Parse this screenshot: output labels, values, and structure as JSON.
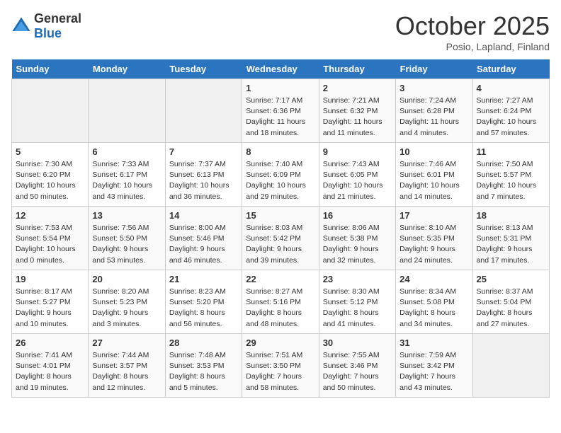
{
  "header": {
    "logo_general": "General",
    "logo_blue": "Blue",
    "month": "October 2025",
    "location": "Posio, Lapland, Finland"
  },
  "days_of_week": [
    "Sunday",
    "Monday",
    "Tuesday",
    "Wednesday",
    "Thursday",
    "Friday",
    "Saturday"
  ],
  "weeks": [
    [
      {
        "day": "",
        "info": ""
      },
      {
        "day": "",
        "info": ""
      },
      {
        "day": "",
        "info": ""
      },
      {
        "day": "1",
        "info": "Sunrise: 7:17 AM\nSunset: 6:36 PM\nDaylight: 11 hours\nand 18 minutes."
      },
      {
        "day": "2",
        "info": "Sunrise: 7:21 AM\nSunset: 6:32 PM\nDaylight: 11 hours\nand 11 minutes."
      },
      {
        "day": "3",
        "info": "Sunrise: 7:24 AM\nSunset: 6:28 PM\nDaylight: 11 hours\nand 4 minutes."
      },
      {
        "day": "4",
        "info": "Sunrise: 7:27 AM\nSunset: 6:24 PM\nDaylight: 10 hours\nand 57 minutes."
      }
    ],
    [
      {
        "day": "5",
        "info": "Sunrise: 7:30 AM\nSunset: 6:20 PM\nDaylight: 10 hours\nand 50 minutes."
      },
      {
        "day": "6",
        "info": "Sunrise: 7:33 AM\nSunset: 6:17 PM\nDaylight: 10 hours\nand 43 minutes."
      },
      {
        "day": "7",
        "info": "Sunrise: 7:37 AM\nSunset: 6:13 PM\nDaylight: 10 hours\nand 36 minutes."
      },
      {
        "day": "8",
        "info": "Sunrise: 7:40 AM\nSunset: 6:09 PM\nDaylight: 10 hours\nand 29 minutes."
      },
      {
        "day": "9",
        "info": "Sunrise: 7:43 AM\nSunset: 6:05 PM\nDaylight: 10 hours\nand 21 minutes."
      },
      {
        "day": "10",
        "info": "Sunrise: 7:46 AM\nSunset: 6:01 PM\nDaylight: 10 hours\nand 14 minutes."
      },
      {
        "day": "11",
        "info": "Sunrise: 7:50 AM\nSunset: 5:57 PM\nDaylight: 10 hours\nand 7 minutes."
      }
    ],
    [
      {
        "day": "12",
        "info": "Sunrise: 7:53 AM\nSunset: 5:54 PM\nDaylight: 10 hours\nand 0 minutes."
      },
      {
        "day": "13",
        "info": "Sunrise: 7:56 AM\nSunset: 5:50 PM\nDaylight: 9 hours\nand 53 minutes."
      },
      {
        "day": "14",
        "info": "Sunrise: 8:00 AM\nSunset: 5:46 PM\nDaylight: 9 hours\nand 46 minutes."
      },
      {
        "day": "15",
        "info": "Sunrise: 8:03 AM\nSunset: 5:42 PM\nDaylight: 9 hours\nand 39 minutes."
      },
      {
        "day": "16",
        "info": "Sunrise: 8:06 AM\nSunset: 5:38 PM\nDaylight: 9 hours\nand 32 minutes."
      },
      {
        "day": "17",
        "info": "Sunrise: 8:10 AM\nSunset: 5:35 PM\nDaylight: 9 hours\nand 24 minutes."
      },
      {
        "day": "18",
        "info": "Sunrise: 8:13 AM\nSunset: 5:31 PM\nDaylight: 9 hours\nand 17 minutes."
      }
    ],
    [
      {
        "day": "19",
        "info": "Sunrise: 8:17 AM\nSunset: 5:27 PM\nDaylight: 9 hours\nand 10 minutes."
      },
      {
        "day": "20",
        "info": "Sunrise: 8:20 AM\nSunset: 5:23 PM\nDaylight: 9 hours\nand 3 minutes."
      },
      {
        "day": "21",
        "info": "Sunrise: 8:23 AM\nSunset: 5:20 PM\nDaylight: 8 hours\nand 56 minutes."
      },
      {
        "day": "22",
        "info": "Sunrise: 8:27 AM\nSunset: 5:16 PM\nDaylight: 8 hours\nand 48 minutes."
      },
      {
        "day": "23",
        "info": "Sunrise: 8:30 AM\nSunset: 5:12 PM\nDaylight: 8 hours\nand 41 minutes."
      },
      {
        "day": "24",
        "info": "Sunrise: 8:34 AM\nSunset: 5:08 PM\nDaylight: 8 hours\nand 34 minutes."
      },
      {
        "day": "25",
        "info": "Sunrise: 8:37 AM\nSunset: 5:04 PM\nDaylight: 8 hours\nand 27 minutes."
      }
    ],
    [
      {
        "day": "26",
        "info": "Sunrise: 7:41 AM\nSunset: 4:01 PM\nDaylight: 8 hours\nand 19 minutes."
      },
      {
        "day": "27",
        "info": "Sunrise: 7:44 AM\nSunset: 3:57 PM\nDaylight: 8 hours\nand 12 minutes."
      },
      {
        "day": "28",
        "info": "Sunrise: 7:48 AM\nSunset: 3:53 PM\nDaylight: 8 hours\nand 5 minutes."
      },
      {
        "day": "29",
        "info": "Sunrise: 7:51 AM\nSunset: 3:50 PM\nDaylight: 7 hours\nand 58 minutes."
      },
      {
        "day": "30",
        "info": "Sunrise: 7:55 AM\nSunset: 3:46 PM\nDaylight: 7 hours\nand 50 minutes."
      },
      {
        "day": "31",
        "info": "Sunrise: 7:59 AM\nSunset: 3:42 PM\nDaylight: 7 hours\nand 43 minutes."
      },
      {
        "day": "",
        "info": ""
      }
    ]
  ]
}
